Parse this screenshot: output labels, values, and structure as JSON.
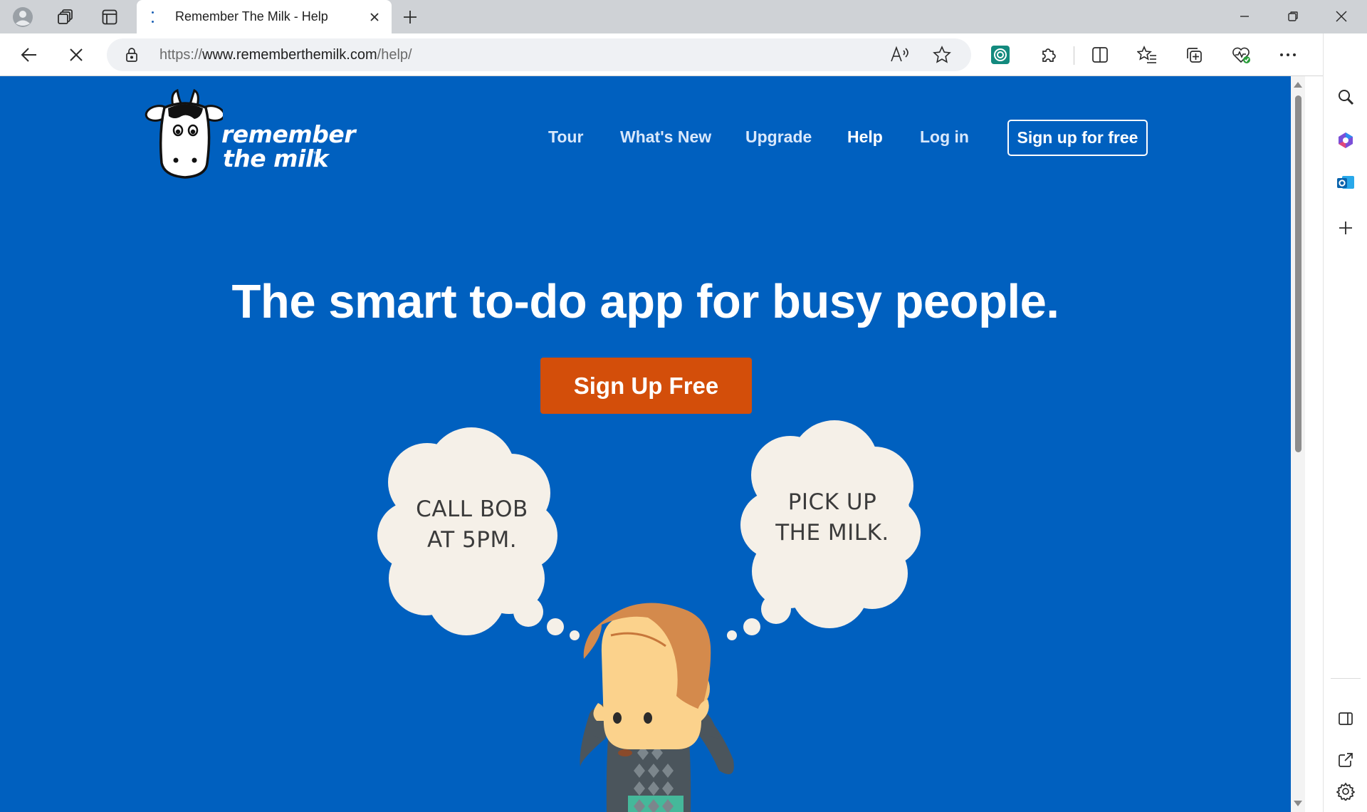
{
  "browser": {
    "tab_title": "Remember The Milk - Help",
    "url_scheme": "https://",
    "url_host": "www.rememberthemilk.com",
    "url_path": "/help/"
  },
  "page": {
    "logo_line1": "remember",
    "logo_line2": "the milk",
    "logo_tm": "™",
    "nav": {
      "tour": "Tour",
      "whats_new": "What's New",
      "upgrade": "Upgrade",
      "help": "Help",
      "login": "Log in",
      "signup": "Sign up for free"
    },
    "hero_title": "The smart to-do app for busy people.",
    "cta_label": "Sign Up Free",
    "bubble_left_line1": "CALL BOB",
    "bubble_left_line2": "AT 5PM.",
    "bubble_right_line1": "PICK UP",
    "bubble_right_line2": "THE MILK."
  },
  "colors": {
    "page_background": "#0060bf",
    "cta_background": "#d34e0a",
    "bubble_fill": "#f5f0e8"
  },
  "icons": {
    "tabstrip": [
      "profile-icon",
      "workspaces-icon",
      "tab-actions-icon",
      "loading-icon",
      "close-icon",
      "plus-icon",
      "minimize-icon",
      "restore-icon",
      "close-window-icon"
    ],
    "toolbar": [
      "back-icon",
      "stop-icon",
      "lock-icon",
      "read-aloud-icon",
      "favorite-star-icon",
      "extension-app-icon",
      "extensions-puzzle-icon",
      "split-screen-icon",
      "favorites-icon",
      "collections-icon",
      "browser-essentials-icon",
      "more-icon",
      "copilot-icon"
    ],
    "sidebar": [
      "search-icon",
      "copilot-sidebar-icon",
      "outlook-icon",
      "add-icon",
      "hide-sidebar-icon",
      "external-link-icon",
      "settings-gear-icon"
    ]
  }
}
